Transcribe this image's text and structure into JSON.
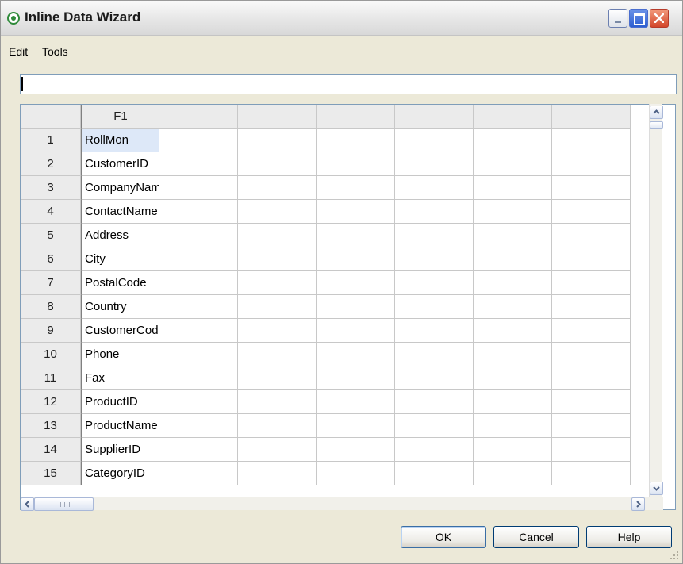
{
  "window": {
    "title": "Inline Data Wizard",
    "accent_color": "#2f8a3a"
  },
  "menu": {
    "items": [
      "Edit",
      "Tools"
    ]
  },
  "formula_bar": {
    "value": ""
  },
  "grid": {
    "column_headers": [
      "F1",
      "",
      "",
      "",
      "",
      "",
      ""
    ],
    "rows": [
      {
        "num": "1",
        "value": "RollMon"
      },
      {
        "num": "2",
        "value": "CustomerID"
      },
      {
        "num": "3",
        "value": "CompanyName"
      },
      {
        "num": "4",
        "value": "ContactName"
      },
      {
        "num": "5",
        "value": "Address"
      },
      {
        "num": "6",
        "value": "City"
      },
      {
        "num": "7",
        "value": "PostalCode"
      },
      {
        "num": "8",
        "value": "Country"
      },
      {
        "num": "9",
        "value": "CustomerCode"
      },
      {
        "num": "10",
        "value": "Phone"
      },
      {
        "num": "11",
        "value": "Fax"
      },
      {
        "num": "12",
        "value": "ProductID"
      },
      {
        "num": "13",
        "value": "ProductName"
      },
      {
        "num": "14",
        "value": "SupplierID"
      },
      {
        "num": "15",
        "value": "CategoryID"
      }
    ]
  },
  "buttons": {
    "ok": "OK",
    "cancel": "Cancel",
    "help": "Help"
  },
  "icons": {
    "app": "qlik-app-icon",
    "minimize": "minimize-icon",
    "maximize": "maximize-icon",
    "close": "close-icon",
    "scroll_up": "chevron-up-icon",
    "scroll_down": "chevron-down-icon",
    "scroll_left": "chevron-left-icon",
    "scroll_right": "chevron-right-icon"
  }
}
